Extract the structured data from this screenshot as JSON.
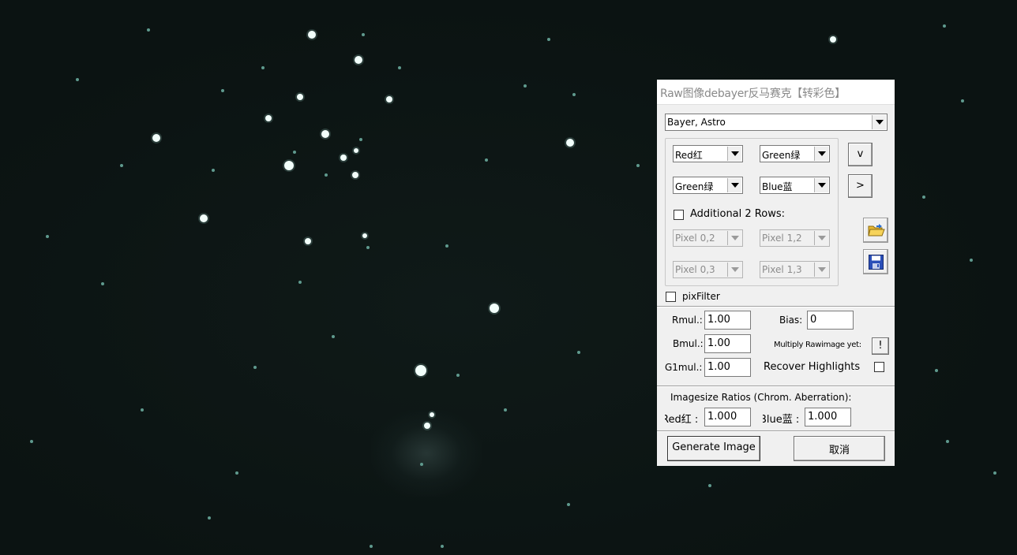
{
  "dialog": {
    "title": "Raw图像debayer反马赛克【转彩色】",
    "pattern_select": "Bayer, Astro",
    "bayer": {
      "row0_col0": "Red红",
      "row0_col1": "Green绿",
      "row1_col0": "Green绿",
      "row1_col1": "Blue蓝",
      "btn_down": "v",
      "btn_right": ">",
      "additional_rows_label": "Additional 2 Rows:",
      "additional_rows_checked": false,
      "pixel_0_2": "Pixel 0,2",
      "pixel_1_2": "Pixel 1,2",
      "pixel_0_3": "Pixel 0,3",
      "pixel_1_3": "Pixel 1,3"
    },
    "pixfilter_label": "pixFilter",
    "pixfilter_checked": false,
    "rmul_label": "Rmul.:",
    "rmul_value": "1.00",
    "bmul_label": "Bmul.:",
    "bmul_value": "1.00",
    "g1mul_label": "G1mul.:",
    "g1mul_value": "1.00",
    "bias_label": "Bias:",
    "bias_value": "0",
    "multiply_label": "Multiply Rawimage yet:",
    "multiply_button": "!",
    "recover_label": "Recover Highlights",
    "recover_checked": false,
    "ratios_label": "Imagesize Ratios (Chrom. Aberration):",
    "red_ratio_label": "Red红 :",
    "red_ratio_value": "1.000",
    "blue_ratio_label": "Blue蓝 :",
    "blue_ratio_value": "1.000",
    "generate_button": "Generate Image",
    "cancel_button": "取消"
  },
  "colors": {
    "sky_background": "#0b1312",
    "dialog_background": "#f0f0f0",
    "title_text": "#8a8a8a"
  },
  "icons": {
    "open": "folder-open-icon",
    "save": "floppy-disk-icon"
  }
}
